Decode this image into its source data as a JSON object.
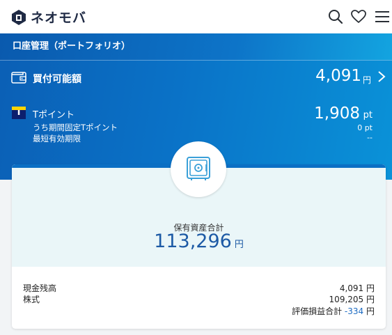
{
  "app": {
    "logo_text": "ネオモバ"
  },
  "header": {
    "icons": [
      "search-icon",
      "heart-icon",
      "menu-icon"
    ]
  },
  "section": {
    "title": "口座管理（ポートフォリオ）"
  },
  "buying_power": {
    "label": "買付可能額",
    "value": "4,091",
    "unit": "円"
  },
  "t_point": {
    "label": "Tポイント",
    "value": "1,908",
    "unit": "pt",
    "limited_label": "うち期間固定Tポイント",
    "limited_value": "0 pt",
    "expiry_label": "最短有効期限",
    "expiry_value": "--"
  },
  "assets": {
    "label": "保有資産合計",
    "value": "113,296",
    "unit": "円",
    "cash_label": "現金残高",
    "cash_value": "4,091 円",
    "stock_label": "株式",
    "stock_value": "109,205 円",
    "pl_label": "評価損益合計",
    "pl_value": "-334",
    "pl_unit": "円"
  },
  "colors": {
    "brand_blue": "#0b6fc4",
    "panel_gradient_start": "#0b5fb5",
    "panel_gradient_end": "#0a92d8",
    "asset_value": "#1d5aa5",
    "negative": "#1c6bc2"
  }
}
